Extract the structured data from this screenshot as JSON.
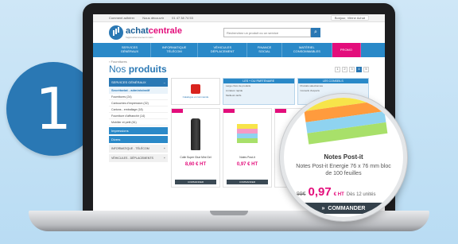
{
  "step_number": "1",
  "colors": {
    "brand_blue": "#2a78b4",
    "nav_blue": "#2a89c8",
    "accent_pink": "#e30d7b",
    "button_dark": "#34414b"
  },
  "topbar": {
    "items": [
      "Comment adhérer",
      "Nous découvrir",
      "01 47 38 74 53"
    ],
    "account": "Bonjour, Vitrine Achat"
  },
  "logo": {
    "name_a": "achat",
    "name_b": "centrale",
    "tagline": "l'approvisionnement malin"
  },
  "search": {
    "placeholder": "Recherchez un produit ou un service",
    "icon": "search-icon"
  },
  "nav": {
    "items": [
      "SERVICES GÉNÉRAUX",
      "INFORMATIQUE TÉLÉCOM",
      "VÉHICULES DÉPLACEMENT",
      "FINANCE SOCIAL",
      "MATÉRIEL CONSOMMABLES"
    ],
    "promo": "PROMO"
  },
  "breadcrumb": "› Fournitures",
  "page_title": {
    "light": "Nos",
    "bold": "produits"
  },
  "pager": {
    "pages": [
      "1",
      "2",
      "3",
      "4",
      "5"
    ],
    "active": "4"
  },
  "sidebar": {
    "head": "SERVICES GÉNÉRAUX",
    "sub": "Secrétariat - administratif",
    "items": [
      "Fournitures (24)",
      "Cartouches d'impression (32)",
      "Cartons - emballage (18)",
      "Fourniture d'affranchir (14)",
      "Mobilier et petit (61)"
    ],
    "sections": [
      "Impressions",
      "Divers"
    ],
    "gray": [
      "INFORMATIQUE - TÉLÉCOM",
      "VÉHICULES - DÉPLACEMENTS"
    ]
  },
  "banners": {
    "red_text": "Catalogue et commande",
    "blue": [
      {
        "head": "LES + DU PARTENAIRE",
        "lines": [
          "Large choix de produits",
          "Livraison rapide",
          "Meilleurs tarifs"
        ]
      },
      {
        "head": "LES CONSEILS",
        "lines": [
          "Produits sélectionnés",
          "Conseils d'experts"
        ]
      }
    ]
  },
  "products": [
    {
      "name": "Colle Super Glue Mini Gel",
      "price": "8,60 € HT",
      "button": "COMMANDER",
      "kind": "stapler"
    },
    {
      "name": "Notes Post-it",
      "price": "0,97 € HT",
      "button": "COMMANDER",
      "kind": "postit"
    }
  ],
  "magnifier": {
    "title": "Notes Post-it",
    "description": "Notes Post-it Energie 76 x 76 mm bloc de 100 feuilles",
    "old_price": "1,99€",
    "new_price": "0,97",
    "unit": "€ HT",
    "quantity": "Dès 12 unités",
    "button": "COMMANDER",
    "button_icon": "double-chevron-right-icon"
  }
}
